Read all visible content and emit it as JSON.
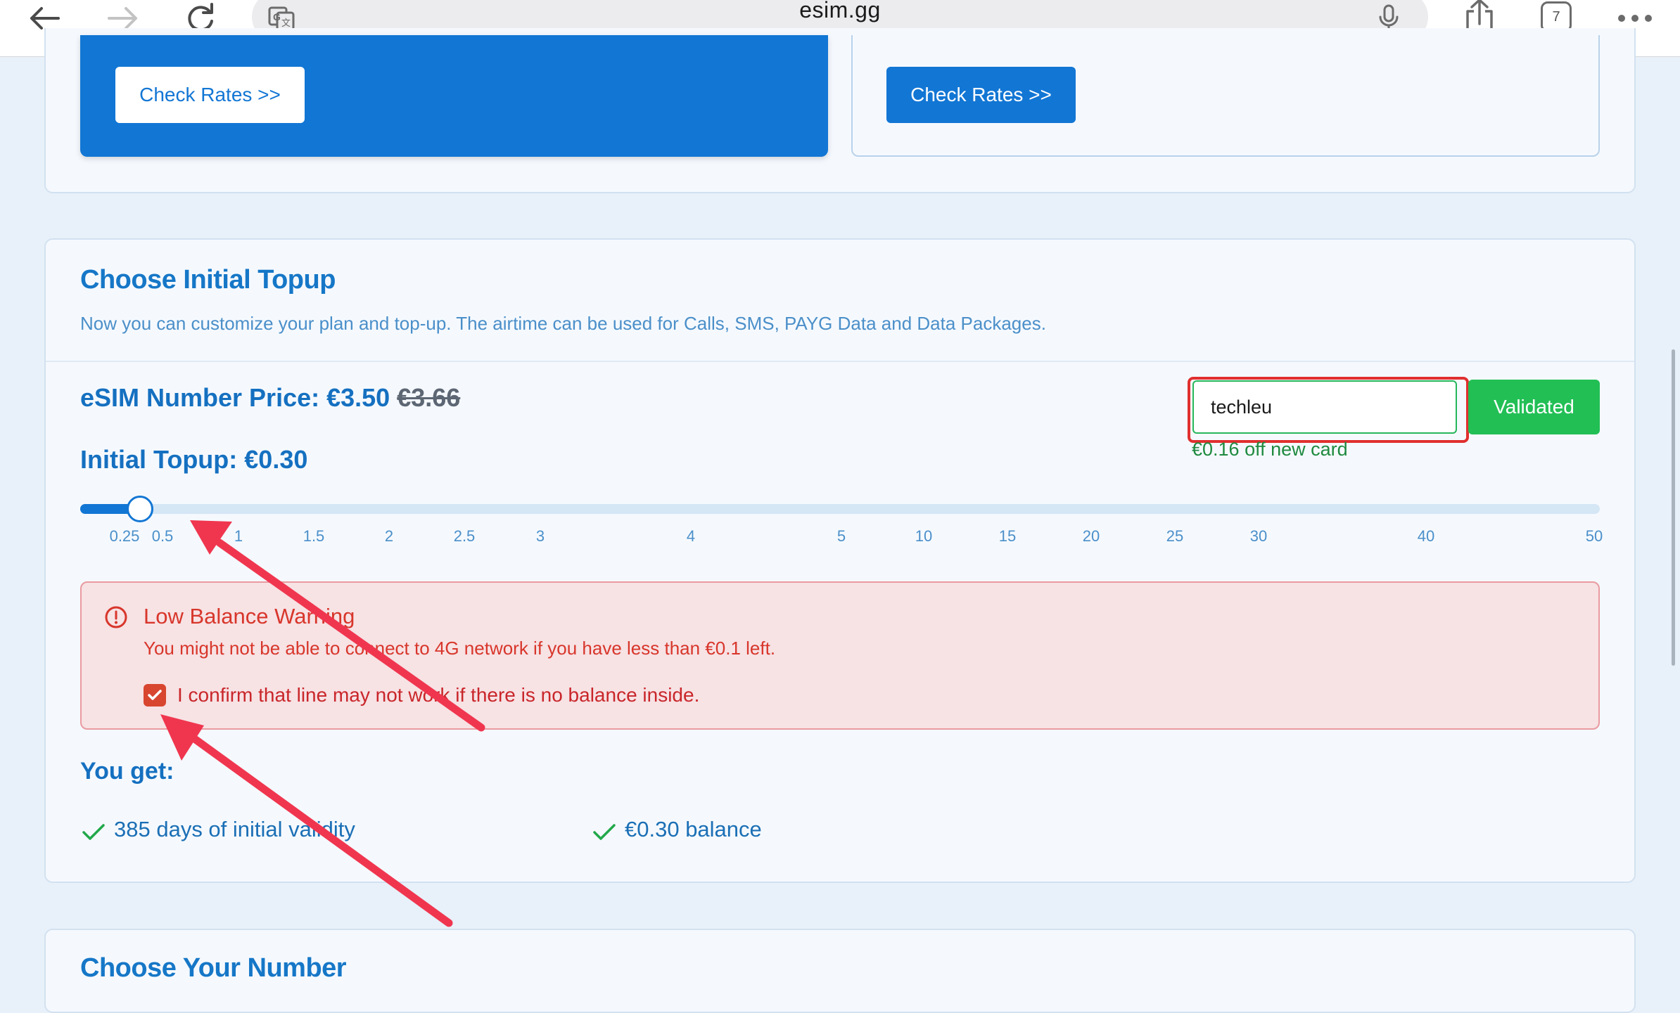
{
  "browser": {
    "url": "esim.gg",
    "tab_count": "7",
    "icons": [
      "back-arrow-icon",
      "forward-arrow-icon",
      "reload-icon",
      "translate-icon",
      "microphone-icon",
      "share-icon",
      "tabs-icon",
      "more-icon"
    ]
  },
  "rates": {
    "left_button": "Check Rates >>",
    "right_button": "Check Rates >>"
  },
  "topup": {
    "title": "Choose Initial Topup",
    "subtitle": "Now you can customize your plan and top-up. The airtime can be used for Calls, SMS, PAYG Data and Data Packages.",
    "price_label": "eSIM Number Price: €3.50",
    "price_old": "€3.66",
    "initial_topup": "Initial Topup: €0.30",
    "promo_code": "techleu",
    "validated_button": "Validated",
    "discount_note": "€0.16 off new card",
    "slider": {
      "ticks": [
        "0.25",
        "0.5",
        "1",
        "1.5",
        "2",
        "2.5",
        "3",
        "4",
        "5",
        "10",
        "15",
        "20",
        "25",
        "30",
        "40",
        "50"
      ],
      "selected_value": 0.3
    },
    "warning": {
      "title": "Low Balance Warning",
      "message": "You might not be able to connect to 4G network if you have less than €0.1 left.",
      "confirm": "I confirm that line may not work if there is no balance inside.",
      "confirmed": true
    },
    "you_get_title": "You get:",
    "benefits": [
      "385 days of initial validity",
      "€0.30 balance"
    ]
  },
  "next_section": {
    "title": "Choose Your Number"
  },
  "colors": {
    "primary": "#1276d4",
    "success": "#22bf55",
    "danger": "#d8362b",
    "annotation": "#f0364f"
  }
}
